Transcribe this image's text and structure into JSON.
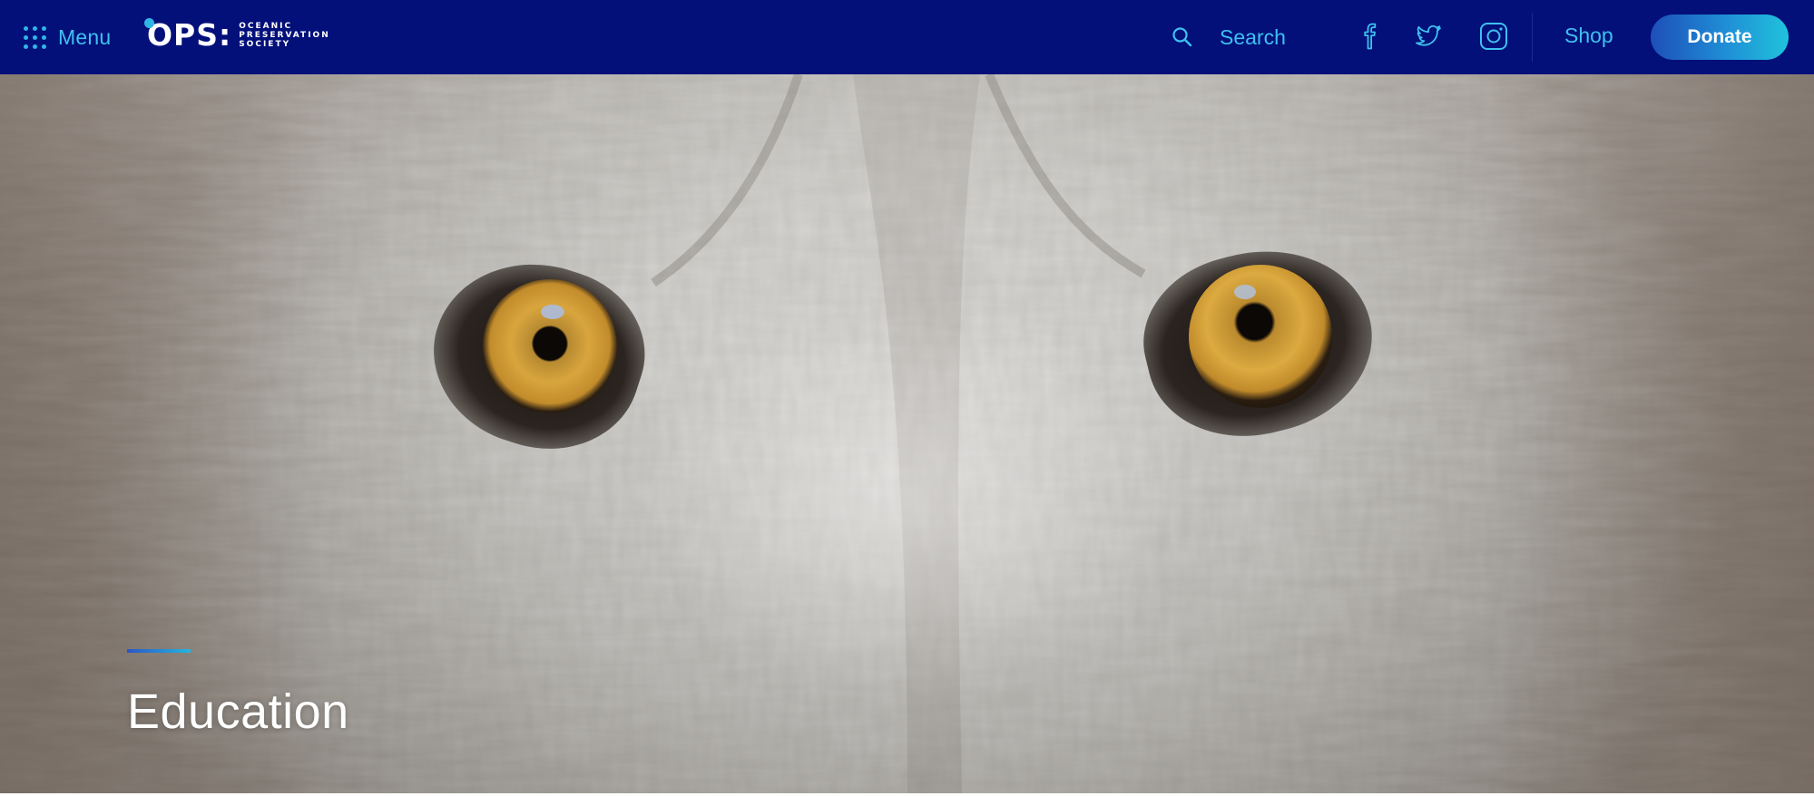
{
  "nav": {
    "menu_label": "Menu",
    "logo": {
      "mark": "OPS:",
      "sub_line1": "OCEANIC",
      "sub_line2": "PRESERVATION",
      "sub_line3": "SOCIETY"
    },
    "search_label": "Search",
    "social": {
      "facebook_icon": "facebook-icon",
      "twitter_icon": "twitter-icon",
      "instagram_icon": "instagram-icon"
    },
    "shop_label": "Shop",
    "donate_label": "Donate"
  },
  "hero": {
    "image": "wolf-eyes-closeup",
    "title": "Education"
  },
  "colors": {
    "nav_background": "#03107a",
    "accent": "#3ec0ef",
    "donate_gradient_start": "#1e4fb8",
    "donate_gradient_end": "#20c2dc",
    "title_text": "#ffffff"
  }
}
